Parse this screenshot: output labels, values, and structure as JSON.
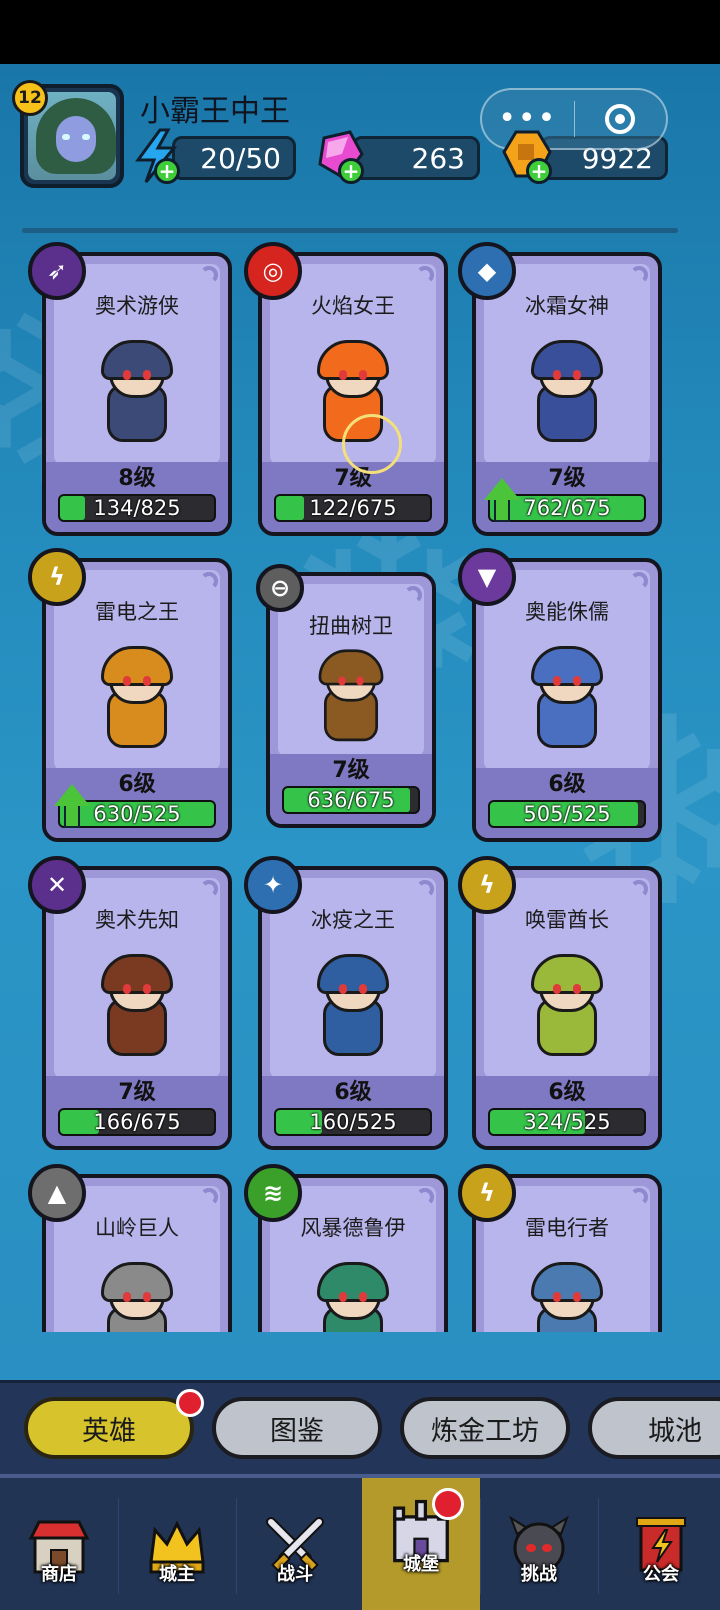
{
  "player": {
    "level": "12",
    "name": "小霸王中王"
  },
  "resources": {
    "energy": "20/50",
    "gems": "263",
    "coins": "9922"
  },
  "heroes": [
    {
      "name": "奥术游侠",
      "level": "8级",
      "progress": "134/825",
      "fill": 0.16,
      "upgradable": false,
      "class_icon": "arcane-arrows-icon",
      "class_color": "#5b2f8c",
      "sprite_color": "#3c4a78"
    },
    {
      "name": "火焰女王",
      "level": "7级",
      "progress": "122/675",
      "fill": 0.18,
      "upgradable": false,
      "class_icon": "fire-target-icon",
      "class_color": "#d6241e",
      "sprite_color": "#f26a1c"
    },
    {
      "name": "冰霜女神",
      "level": "7级",
      "progress": "762/675",
      "fill": 1.0,
      "upgradable": true,
      "class_icon": "ice-crystal-icon",
      "class_color": "#2d6fb1",
      "sprite_color": "#3a4f9a"
    },
    {
      "name": "雷电之王",
      "level": "6级",
      "progress": "630/525",
      "fill": 1.0,
      "upgradable": true,
      "class_icon": "lightning-icon",
      "class_color": "#c9a21c",
      "sprite_color": "#d98c1e"
    },
    {
      "name": "扭曲树卫",
      "level": "7级",
      "progress": "636/675",
      "fill": 0.94,
      "upgradable": false,
      "class_icon": "shield-icon",
      "class_color": "#5e5e5e",
      "sprite_color": "#8a5a22"
    },
    {
      "name": "奥能侏儒",
      "level": "6级",
      "progress": "505/525",
      "fill": 0.96,
      "upgradable": false,
      "class_icon": "arcane-shield-icon",
      "class_color": "#6b3a9c",
      "sprite_color": "#4a6fc0"
    },
    {
      "name": "奥术先知",
      "level": "7级",
      "progress": "166/675",
      "fill": 0.25,
      "upgradable": false,
      "class_icon": "arcane-swords-icon",
      "class_color": "#5b2f8c",
      "sprite_color": "#7a3a22"
    },
    {
      "name": "冰疫之王",
      "level": "6级",
      "progress": "160/525",
      "fill": 0.3,
      "upgradable": false,
      "class_icon": "ice-shards-icon",
      "class_color": "#2d6fb1",
      "sprite_color": "#2f5fa0"
    },
    {
      "name": "唤雷酋长",
      "level": "6级",
      "progress": "324/525",
      "fill": 0.62,
      "upgradable": false,
      "class_icon": "thunder-icon",
      "class_color": "#c9a21c",
      "sprite_color": "#9ab83a"
    },
    {
      "name": "山岭巨人",
      "level": "",
      "progress": "",
      "fill": 0,
      "upgradable": false,
      "class_icon": "rock-icon",
      "class_color": "#6e6e6e",
      "sprite_color": "#8a8a8a"
    },
    {
      "name": "风暴德鲁伊",
      "level": "",
      "progress": "",
      "fill": 0,
      "upgradable": false,
      "class_icon": "tornado-icon",
      "class_color": "#3aa02a",
      "sprite_color": "#2f8a6a"
    },
    {
      "name": "雷电行者",
      "level": "",
      "progress": "",
      "fill": 0,
      "upgradable": false,
      "class_icon": "thunder-bolt-icon",
      "class_color": "#c9a21c",
      "sprite_color": "#4a7ab0"
    }
  ],
  "subtabs": [
    "英雄",
    "图鉴",
    "炼金工坊",
    "城池"
  ],
  "nav": [
    "商店",
    "城主",
    "战斗",
    "城堡",
    "挑战",
    "公会"
  ]
}
